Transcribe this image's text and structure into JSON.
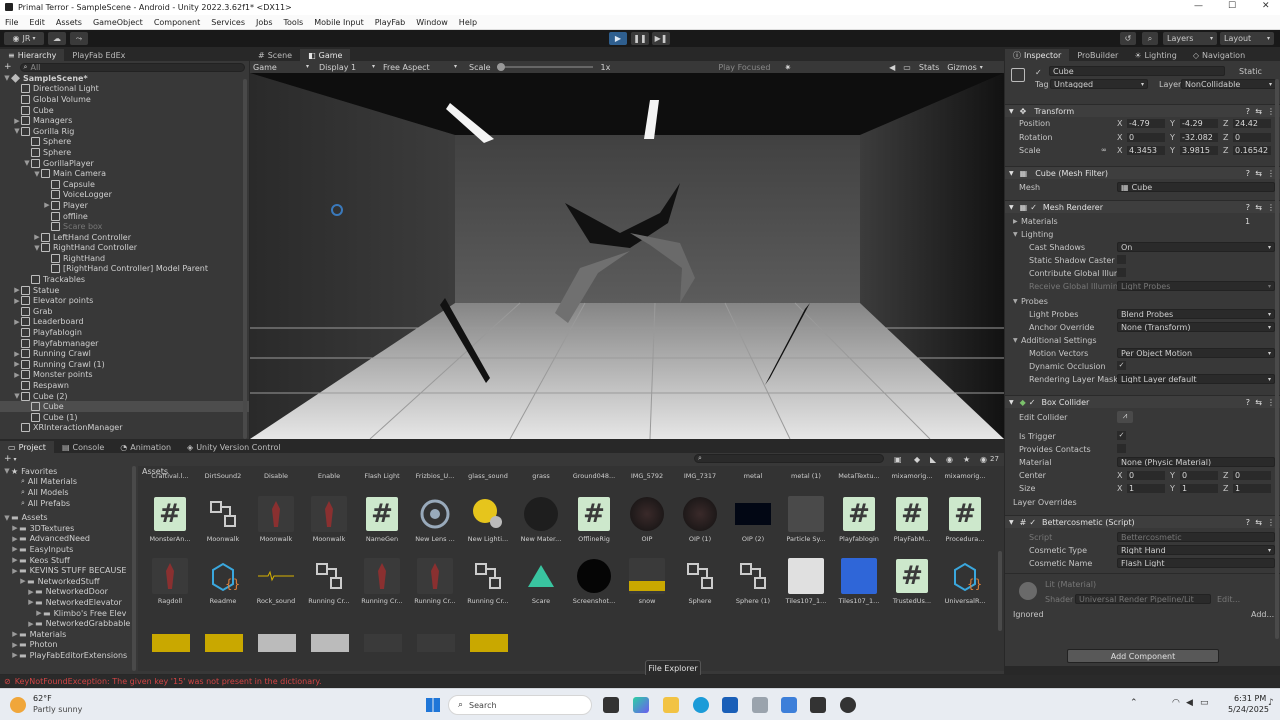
{
  "window": {
    "title": "Primal Terror - SampleScene - Android - Unity 2022.3.62f1* <DX11>"
  },
  "menu": [
    "File",
    "Edit",
    "Assets",
    "GameObject",
    "Component",
    "Services",
    "Jobs",
    "Tools",
    "Mobile Input",
    "PlayFab",
    "Window",
    "Help"
  ],
  "toolbar": {
    "account": "JR",
    "layers": "Layers",
    "layout": "Layout"
  },
  "hierarchy": {
    "tabs": [
      "Hierarchy",
      "PlayFab EdEx"
    ],
    "search_placeholder": "All",
    "items": [
      {
        "label": "SampleScene*",
        "depth": 0,
        "arrow": "▼",
        "icon": "unity-scene-icon"
      },
      {
        "label": "Directional Light",
        "depth": 1,
        "arrow": ""
      },
      {
        "label": "Global Volume",
        "depth": 1,
        "arrow": ""
      },
      {
        "label": "Cube",
        "depth": 1,
        "arrow": ""
      },
      {
        "label": "Managers",
        "depth": 1,
        "arrow": "▶"
      },
      {
        "label": "Gorilla Rig",
        "depth": 1,
        "arrow": "▼"
      },
      {
        "label": "Sphere",
        "depth": 2,
        "arrow": ""
      },
      {
        "label": "Sphere",
        "depth": 2,
        "arrow": ""
      },
      {
        "label": "GorillaPlayer",
        "depth": 2,
        "arrow": "▼"
      },
      {
        "label": "Main Camera",
        "depth": 3,
        "arrow": "▼"
      },
      {
        "label": "Capsule",
        "depth": 4,
        "arrow": ""
      },
      {
        "label": "VoiceLogger",
        "depth": 4,
        "arrow": ""
      },
      {
        "label": "Player",
        "depth": 4,
        "arrow": "▶"
      },
      {
        "label": "offline",
        "depth": 4,
        "arrow": ""
      },
      {
        "label": "Scare box",
        "depth": 4,
        "arrow": "",
        "dim": true
      },
      {
        "label": "LeftHand Controller",
        "depth": 3,
        "arrow": "▶"
      },
      {
        "label": "RightHand Controller",
        "depth": 3,
        "arrow": "▼"
      },
      {
        "label": "RightHand",
        "depth": 4,
        "arrow": ""
      },
      {
        "label": "[RightHand Controller] Model Parent",
        "depth": 4,
        "arrow": ""
      },
      {
        "label": "Trackables",
        "depth": 2,
        "arrow": ""
      },
      {
        "label": "Statue",
        "depth": 1,
        "arrow": "▶"
      },
      {
        "label": "Elevator points",
        "depth": 1,
        "arrow": "▶"
      },
      {
        "label": "Grab",
        "depth": 1,
        "arrow": ""
      },
      {
        "label": "Leaderboard",
        "depth": 1,
        "arrow": "▶"
      },
      {
        "label": "Playfablogin",
        "depth": 1,
        "arrow": ""
      },
      {
        "label": "Playfabmanager",
        "depth": 1,
        "arrow": ""
      },
      {
        "label": "Running Crawl",
        "depth": 1,
        "arrow": "▶"
      },
      {
        "label": "Running Crawl (1)",
        "depth": 1,
        "arrow": "▶"
      },
      {
        "label": "Monster points",
        "depth": 1,
        "arrow": "▶"
      },
      {
        "label": "Respawn",
        "depth": 1,
        "arrow": ""
      },
      {
        "label": "Cube (2)",
        "depth": 1,
        "arrow": "▼"
      },
      {
        "label": "Cube",
        "depth": 2,
        "arrow": "",
        "selected": true
      },
      {
        "label": "Cube (1)",
        "depth": 2,
        "arrow": ""
      },
      {
        "label": "XRInteractionManager",
        "depth": 1,
        "arrow": ""
      }
    ]
  },
  "scene": {
    "tabs": [
      "Scene",
      "Game"
    ],
    "game_bar": {
      "mode": "Game",
      "display": "Display 1",
      "aspect": "Free Aspect",
      "scale_label": "Scale",
      "scale_value": "1x",
      "play_focused": "Play Focused",
      "stats": "Stats",
      "gizmos": "Gizmos"
    }
  },
  "inspector": {
    "tabs": [
      "Inspector",
      "ProBuilder",
      "Lighting",
      "Navigation"
    ],
    "object_name": "Cube",
    "static_label": "Static",
    "tag_label": "Tag",
    "tag_value": "Untagged",
    "layer_label": "Layer",
    "layer_value": "NonCollidable",
    "transform": {
      "title": "Transform",
      "position": {
        "label": "Position",
        "x": "-4.79",
        "y": "-4.29",
        "z": "24.42"
      },
      "rotation": {
        "label": "Rotation",
        "x": "0",
        "y": "-32.082",
        "z": "0"
      },
      "scale": {
        "label": "Scale",
        "x": "4.3453",
        "y": "3.9815",
        "z": "0.16542"
      }
    },
    "mesh_filter": {
      "title": "Cube (Mesh Filter)",
      "mesh_label": "Mesh",
      "mesh_value": "Cube"
    },
    "mesh_renderer": {
      "title": "Mesh Renderer",
      "materials_label": "Materials",
      "materials_count": "1",
      "lighting_label": "Lighting",
      "cast_shadows_label": "Cast Shadows",
      "cast_shadows_value": "On",
      "static_shadow_label": "Static Shadow Caster",
      "contribute_gi_label": "Contribute Global Illumi",
      "receive_gi_label": "Receive Global Illumina",
      "receive_gi_value": "Light Probes",
      "probes_label": "Probes",
      "light_probes_label": "Light Probes",
      "light_probes_value": "Blend Probes",
      "anchor_label": "Anchor Override",
      "anchor_value": "None (Transform)",
      "additional_label": "Additional Settings",
      "motion_label": "Motion Vectors",
      "motion_value": "Per Object Motion",
      "dynamic_occ_label": "Dynamic Occlusion",
      "rendering_mask_label": "Rendering Layer Mask",
      "rendering_mask_value": "Light Layer default"
    },
    "box_collider": {
      "title": "Box Collider",
      "edit_label": "Edit Collider",
      "trigger_label": "Is Trigger",
      "contacts_label": "Provides Contacts",
      "material_label": "Material",
      "material_value": "None (Physic Material)",
      "center_label": "Center",
      "center": {
        "x": "0",
        "y": "0",
        "z": "0"
      },
      "size_label": "Size",
      "size": {
        "x": "1",
        "y": "1",
        "z": "1"
      },
      "overrides_label": "Layer Overrides"
    },
    "script": {
      "title": "Bettercosmetic (Script)",
      "script_label": "Script",
      "script_value": "Bettercosmetic",
      "type_label": "Cosmetic Type",
      "type_value": "Right Hand",
      "name_label": "Cosmetic Name",
      "name_value": "Flash Light"
    },
    "material": {
      "name": "Lit (Material)",
      "shader_label": "Shader",
      "shader_value": "Universal Render Pipeline/Lit",
      "edit": "Edit...",
      "ignored": "Ignored",
      "add": "Add..."
    },
    "add_component": "Add Component"
  },
  "project": {
    "tabs": [
      "Project",
      "Console",
      "Animation",
      "Unity Version Control"
    ],
    "count": "27",
    "favorites": {
      "label": "Favorites",
      "items": [
        "All Materials",
        "All Models",
        "All Prefabs"
      ]
    },
    "assets_tree": {
      "label": "Assets",
      "items": [
        {
          "label": "3DTextures",
          "depth": 1
        },
        {
          "label": "AdvancedNeed",
          "depth": 1
        },
        {
          "label": "EasyInputs",
          "depth": 1
        },
        {
          "label": "Keos Stuff",
          "depth": 1
        },
        {
          "label": "KEVINS STUFF BECAUSE",
          "depth": 1
        },
        {
          "label": "NetworkedStuff",
          "depth": 2
        },
        {
          "label": "NetworkedDoor",
          "depth": 3
        },
        {
          "label": "NetworkedElevator",
          "depth": 3
        },
        {
          "label": "Klimbo's Free Elev",
          "depth": 4
        },
        {
          "label": "NetworkedGrabbable",
          "depth": 3
        },
        {
          "label": "Materials",
          "depth": 1
        },
        {
          "label": "Photon",
          "depth": 1
        },
        {
          "label": "PlayFabEditorExtensions",
          "depth": 1
        }
      ]
    },
    "breadcrumb": "Assets",
    "row1": [
      "Craftival.l...",
      "DirtSound2",
      "Disable",
      "Enable",
      "Flash Light",
      "Frizbios_U...",
      "glass_sound",
      "grass",
      "Ground048...",
      "IMG_5792",
      "IMG_7317",
      "metal",
      "metal (1)",
      "MetalTextu...",
      "mixamorig...",
      "mixamorig..."
    ],
    "row2": [
      {
        "label": "MonsterAn...",
        "kind": "script"
      },
      {
        "label": "Moonwalk",
        "kind": "anim"
      },
      {
        "label": "Moonwalk",
        "kind": "model"
      },
      {
        "label": "Moonwalk",
        "kind": "model"
      },
      {
        "label": "NameGen",
        "kind": "script"
      },
      {
        "label": "New Lens ...",
        "kind": "lens"
      },
      {
        "label": "New Lighti...",
        "kind": "lighting"
      },
      {
        "label": "New Mater...",
        "kind": "darkball"
      },
      {
        "label": "OfflineRig",
        "kind": "script"
      },
      {
        "label": "OIP",
        "kind": "noise"
      },
      {
        "label": "OIP (1)",
        "kind": "noise"
      },
      {
        "label": "OIP (2)",
        "kind": "darkrect"
      },
      {
        "label": "Particle Sy...",
        "kind": "gray"
      },
      {
        "label": "Playfablogin",
        "kind": "script"
      },
      {
        "label": "PlayFabM...",
        "kind": "script"
      },
      {
        "label": "Procedura...",
        "kind": "script"
      }
    ],
    "row3": [
      {
        "label": "Ragdoll",
        "kind": "model"
      },
      {
        "label": "Readme",
        "kind": "readme"
      },
      {
        "label": "Rock_sound",
        "kind": "audio"
      },
      {
        "label": "Running Cr...",
        "kind": "anim"
      },
      {
        "label": "Running Cr...",
        "kind": "model"
      },
      {
        "label": "Running Cr...",
        "kind": "model"
      },
      {
        "label": "Running Cr...",
        "kind": "anim"
      },
      {
        "label": "Scare",
        "kind": "scare"
      },
      {
        "label": "Screenshot...",
        "kind": "blackball"
      },
      {
        "label": "snow",
        "kind": "snow"
      },
      {
        "label": "Sphere",
        "kind": "anim"
      },
      {
        "label": "Sphere (1)",
        "kind": "anim"
      },
      {
        "label": "Tiles107_1...",
        "kind": "white"
      },
      {
        "label": "Tiles107_1...",
        "kind": "blue"
      },
      {
        "label": "TrustedUs...",
        "kind": "script"
      },
      {
        "label": "UniversalR...",
        "kind": "readme"
      }
    ],
    "tooltip": "File Explorer"
  },
  "status": {
    "error": "KeyNotFoundException: The given key '15' was not present in the dictionary."
  },
  "taskbar": {
    "weather_temp": "62°F",
    "weather_desc": "Partly sunny",
    "search": "Search",
    "time": "6:31 PM",
    "date": "5/24/2025"
  },
  "colors": {
    "accent": "#3a79bb",
    "selection": "#4d4d4d",
    "script_green": "#cde8cc",
    "error_red": "#d24545"
  }
}
